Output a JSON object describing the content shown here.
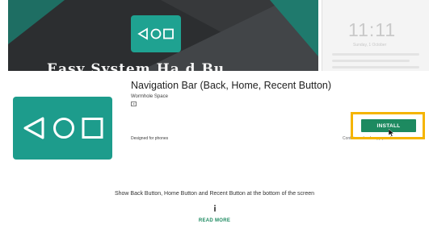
{
  "app": {
    "title": "Navigation Bar (Back, Home, Recent Button)",
    "developer": "Wormhole Space",
    "designed_for": "Designed for phones",
    "compat_note": "Contains ads • In-app purchases",
    "description": "Show Back Button, Home Button and Recent Button at the bottom of the screen",
    "read_more": "READ MORE"
  },
  "install": {
    "label": "INSTALL"
  },
  "screenshots": {
    "promo_text": "Easy System Ha d Bu",
    "lock_time": "11:11",
    "lock_date": "Sunday, 1 October"
  },
  "colors": {
    "brand_teal": "#1d9c8c",
    "install_green": "#1d8a60",
    "highlight": "#f5b400"
  },
  "icons": [
    "back-triangle-icon",
    "home-circle-icon",
    "recent-square-icon",
    "play-badge-icon",
    "cursor-icon",
    "info-icon"
  ]
}
